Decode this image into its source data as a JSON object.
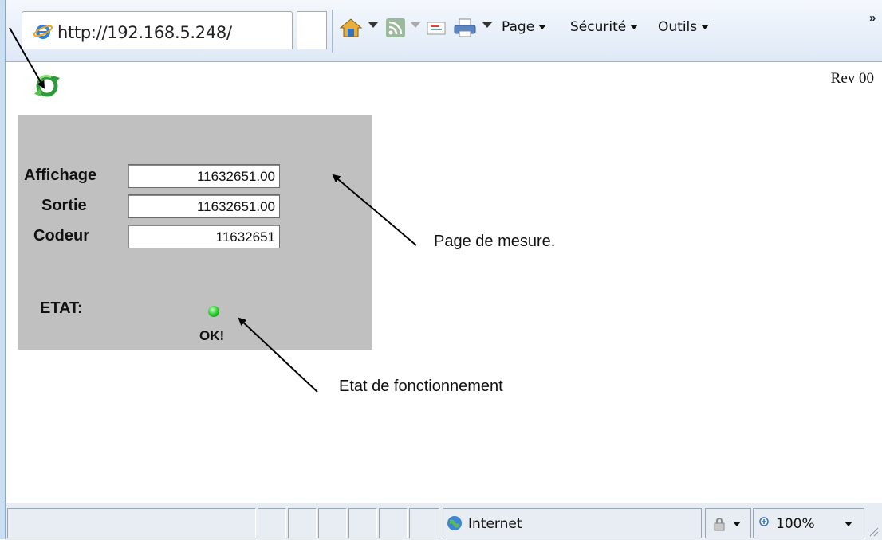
{
  "browser": {
    "tab_url": "http://192.168.5.248/",
    "menus": [
      "Page",
      "Sécurité",
      "Outils"
    ],
    "overflow": "»",
    "toolbar_icons": [
      "home-icon",
      "rss-feed-icon",
      "mail-icon",
      "printer-icon"
    ]
  },
  "page": {
    "revision": "Rev 00",
    "logo_icon": "refresh-logo-icon",
    "fields": [
      {
        "label": "Affichage",
        "value": "11632651.00"
      },
      {
        "label": "Sortie",
        "value": "11632651.00"
      },
      {
        "label": "Codeur",
        "value": "11632651"
      }
    ],
    "etat_label": "ETAT:",
    "status_text": "OK!",
    "led_color": "#26c426"
  },
  "annotations": {
    "measure_page": "Page de mesure.",
    "operating_state": "Etat de fonctionnement"
  },
  "statusbar": {
    "zone": "Internet",
    "zoom": "100%"
  },
  "colors": {
    "panel": "#c0c0c0",
    "chrome": "#dfe9f6"
  }
}
